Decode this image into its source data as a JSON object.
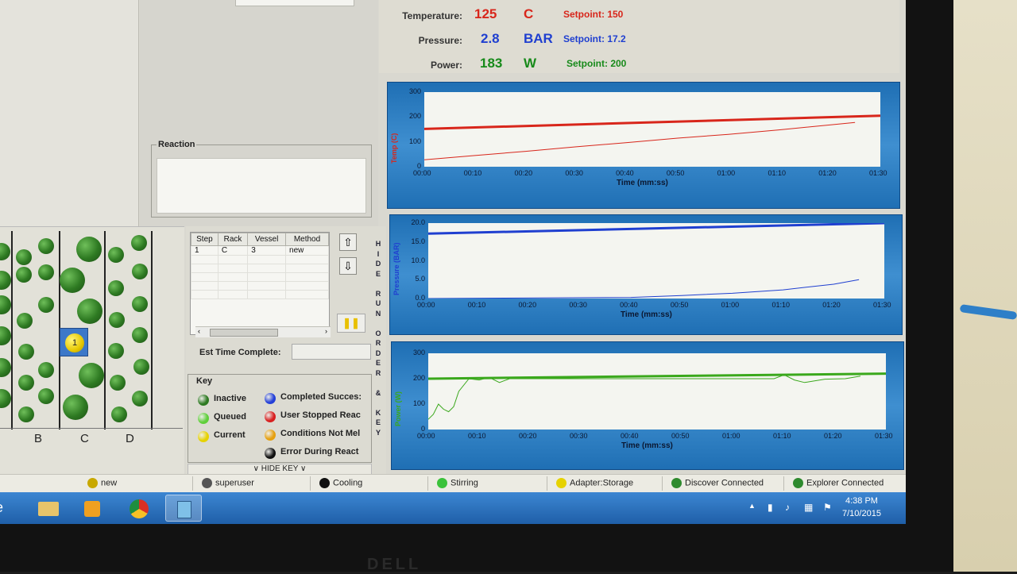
{
  "readouts": {
    "temperature": {
      "label": "Temperature:",
      "value": "125",
      "unit": "C",
      "setpoint": "Setpoint: 150",
      "color": "#d8261b"
    },
    "pressure": {
      "label": "Pressure:",
      "value": "2.8",
      "unit": "BAR",
      "setpoint": "Setpoint: 17.2",
      "color": "#1f3fd0"
    },
    "power": {
      "label": "Power:",
      "value": "183",
      "unit": "W",
      "setpoint": "Setpoint: 200",
      "color": "#178a1a"
    }
  },
  "reaction": {
    "title": "Reaction"
  },
  "charts": [
    {
      "type": "line",
      "yticks": [
        "300",
        "200",
        "100",
        "0"
      ],
      "ylabel": "Temp (C)",
      "xticks": [
        "00:00",
        "00:10",
        "00:20",
        "00:30",
        "00:40",
        "00:50",
        "01:00",
        "01:10",
        "01:20",
        "01:30"
      ],
      "xlabel": "Time (mm:ss)",
      "ylim": [
        0,
        300
      ],
      "color": "#d8261b",
      "series": [
        {
          "x": [
            0,
            90
          ],
          "y": [
            152,
            205
          ]
        },
        {
          "x": [
            0,
            10,
            20,
            30,
            40,
            50,
            60,
            70,
            80,
            85
          ],
          "y": [
            28,
            45,
            62,
            80,
            97,
            115,
            130,
            148,
            168,
            178
          ]
        }
      ]
    },
    {
      "type": "line",
      "yticks": [
        "20.0",
        "15.0",
        "10.0",
        "5.0",
        "0.0"
      ],
      "ylabel": "Pressure (BAR)",
      "xticks": [
        "00:00",
        "00:10",
        "00:20",
        "00:30",
        "00:40",
        "00:50",
        "01:00",
        "01:10",
        "01:20",
        "01:30"
      ],
      "xlabel": "Time (mm:ss)",
      "ylim": [
        0,
        20
      ],
      "color": "#1f3fd0",
      "series": [
        {
          "x": [
            0,
            90
          ],
          "y": [
            17.2,
            20.0
          ]
        },
        {
          "x": [
            0,
            40,
            50,
            60,
            70,
            80,
            85
          ],
          "y": [
            0,
            0.3,
            0.8,
            1.4,
            2.3,
            3.8,
            5.0
          ]
        }
      ]
    },
    {
      "type": "line",
      "yticks": [
        "300",
        "200",
        "100",
        "0"
      ],
      "ylabel": "Power (W)",
      "xticks": [
        "00:00",
        "00:10",
        "00:20",
        "00:30",
        "00:40",
        "00:50",
        "01:00",
        "01:10",
        "01:20",
        "01:30"
      ],
      "xlabel": "Time (mm:ss)",
      "ylim": [
        0,
        300
      ],
      "color": "#3aa81c",
      "series": [
        {
          "x": [
            0,
            90
          ],
          "y": [
            200,
            220
          ]
        },
        {
          "x": [
            0,
            1,
            2,
            3,
            4,
            5,
            6,
            8,
            10,
            12,
            14,
            16,
            20,
            40,
            60,
            68,
            70,
            72,
            74,
            78,
            82,
            85
          ],
          "y": [
            40,
            60,
            100,
            80,
            70,
            90,
            150,
            200,
            195,
            205,
            185,
            200,
            200,
            200,
            200,
            200,
            215,
            195,
            185,
            198,
            200,
            210
          ]
        }
      ]
    }
  ],
  "rack": {
    "letters": [
      "B",
      "C",
      "D"
    ],
    "current_label": "1"
  },
  "runorder": {
    "headers": [
      "Step",
      "Rack",
      "Vessel",
      "Method"
    ],
    "rows": [
      [
        "1",
        "C",
        "3",
        "new"
      ]
    ],
    "side_text": [
      "H",
      "I",
      "D",
      "E",
      "",
      "R",
      "U",
      "N",
      "",
      "O",
      "R",
      "D",
      "E",
      "R",
      "",
      "&",
      "",
      "K",
      "E",
      "Y"
    ],
    "est_label": "Est Time Complete:"
  },
  "key": {
    "title": "Key",
    "items": [
      {
        "label": "Inactive",
        "color": "#2e7a22"
      },
      {
        "label": "Queued",
        "color": "#5fcf3a"
      },
      {
        "label": "Current",
        "color": "#e6d200"
      },
      {
        "label": "Completed Succes:",
        "color": "#2440d8"
      },
      {
        "label": "User Stopped Reac",
        "color": "#d82020"
      },
      {
        "label": "Conditions Not Mel",
        "color": "#e6a010"
      },
      {
        "label": "Error During React",
        "color": "#111111"
      }
    ],
    "hide_label": "∨ HIDE KEY ∨"
  },
  "status": [
    {
      "label": "new",
      "icon": "gear-icon",
      "color": "#c8a800"
    },
    {
      "label": "superuser",
      "icon": "user-icon",
      "color": "#555555"
    },
    {
      "label": "Cooling",
      "icon": "cooling-indicator-icon",
      "color": "#111111"
    },
    {
      "label": "Stirring",
      "icon": "stirring-indicator-icon",
      "color": "#3bc23b"
    },
    {
      "label": "Adapter:Storage",
      "icon": "adapter-icon",
      "color": "#e6d200"
    },
    {
      "label": "Discover Connected",
      "icon": "connected-icon",
      "color": "#2e8a2e"
    },
    {
      "label": "Explorer Connected",
      "icon": "connected-icon",
      "color": "#2e8a2e"
    }
  ],
  "clock": {
    "time": "4:38 PM",
    "date": "7/10/2015"
  }
}
